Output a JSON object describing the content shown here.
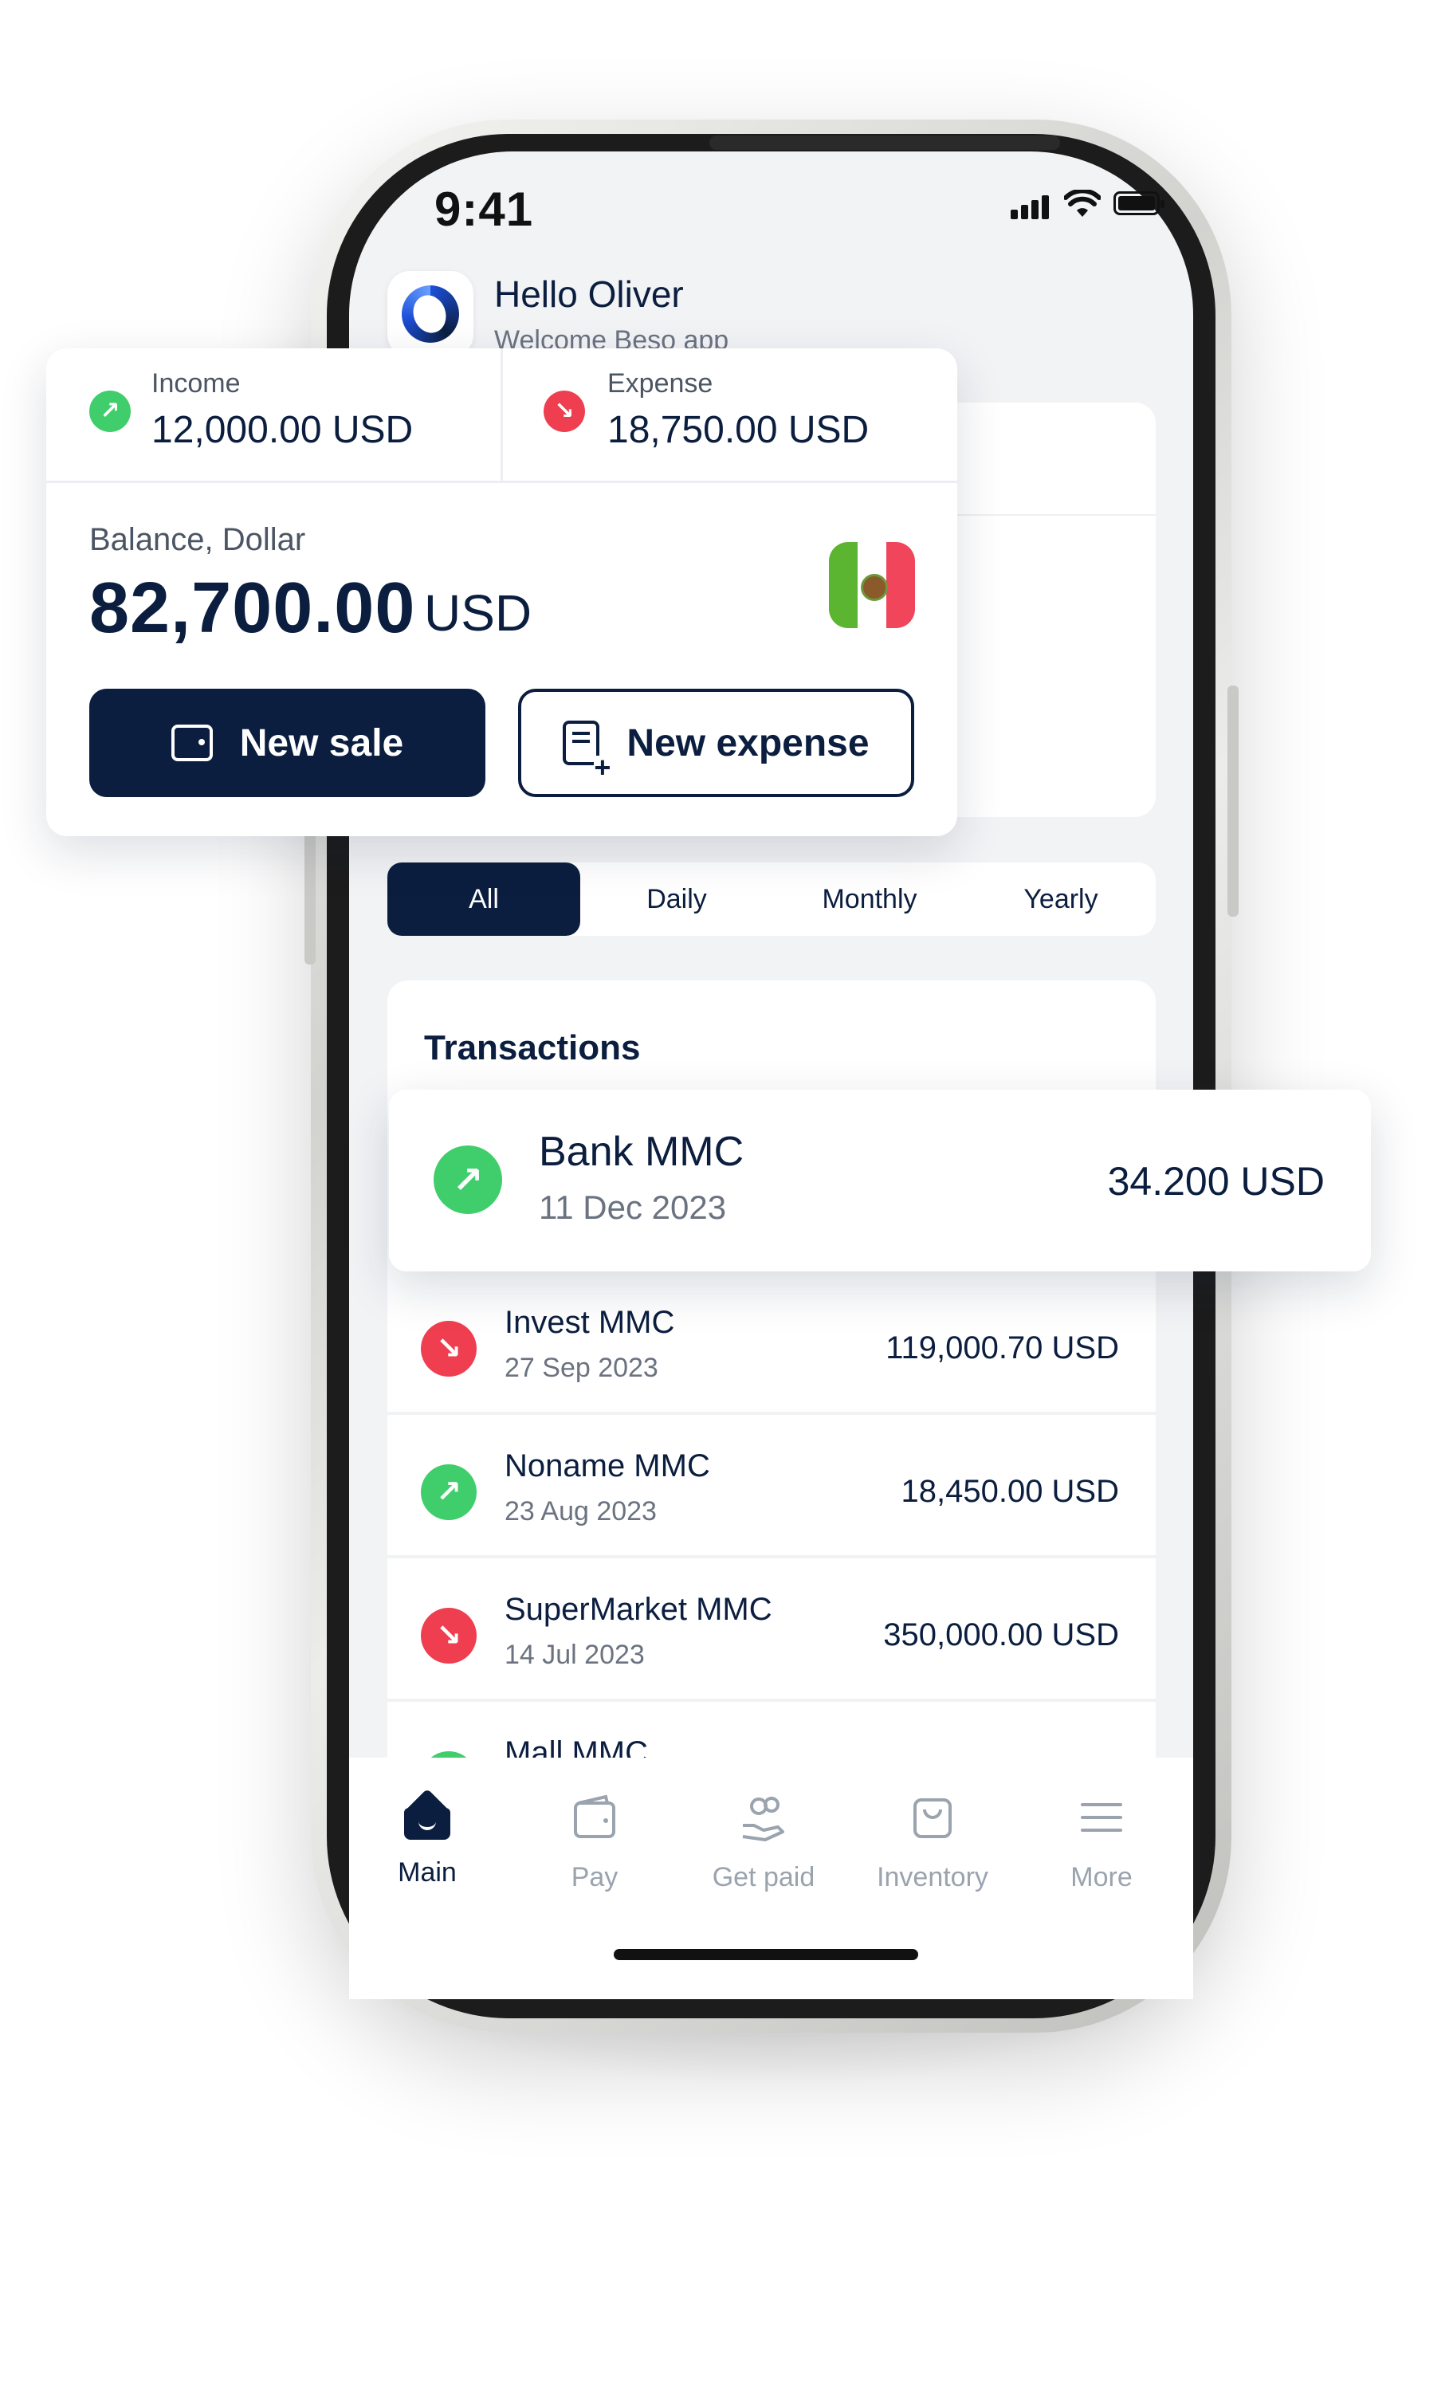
{
  "status_bar": {
    "time": "9:41"
  },
  "header": {
    "greeting": "Hello Oliver",
    "subtitle": "Welcome Beso app"
  },
  "summary": {
    "income": {
      "label": "Income",
      "value": "12,000.00 USD"
    },
    "expense": {
      "label": "Expense",
      "value": "18,750.00 USD"
    },
    "balance": {
      "label": "Balance, Dollar",
      "amount": "82,700.00",
      "currency": "USD"
    },
    "new_sale_label": "New sale",
    "new_expense_label": "New expense"
  },
  "tabs": [
    "All",
    "Daily",
    "Monthly",
    "Yearly"
  ],
  "transactions": {
    "title": "Transactions",
    "featured": {
      "name": "Bank MMC",
      "date": "11 Dec 2023",
      "amount": "34.200 USD",
      "direction": "up"
    },
    "items": [
      {
        "name": "Invest MMC",
        "date": "27 Sep 2023",
        "amount": "119,000.70 USD",
        "direction": "down"
      },
      {
        "name": "Noname MMC",
        "date": "23 Aug 2023",
        "amount": "18,450.00 USD",
        "direction": "up"
      },
      {
        "name": "SuperMarket MMC",
        "date": "14 Jul 2023",
        "amount": "350,000.00 USD",
        "direction": "down"
      },
      {
        "name": "Mall MMC",
        "date": "",
        "amount": "",
        "direction": "up"
      }
    ]
  },
  "bottom_nav": [
    {
      "label": "Main",
      "icon": "home-icon",
      "active": true
    },
    {
      "label": "Pay",
      "icon": "wallet-icon",
      "active": false
    },
    {
      "label": "Get paid",
      "icon": "receive-money-icon",
      "active": false
    },
    {
      "label": "Inventory",
      "icon": "shopping-bag-icon",
      "active": false
    },
    {
      "label": "More",
      "icon": "menu-icon",
      "active": false
    }
  ],
  "colors": {
    "primary": "#0b1e3f",
    "income": "#3fce6b",
    "expense": "#ef3e4f",
    "screen_bg": "#f2f3f5"
  },
  "icons": {
    "up": "↗",
    "down": "↘"
  }
}
